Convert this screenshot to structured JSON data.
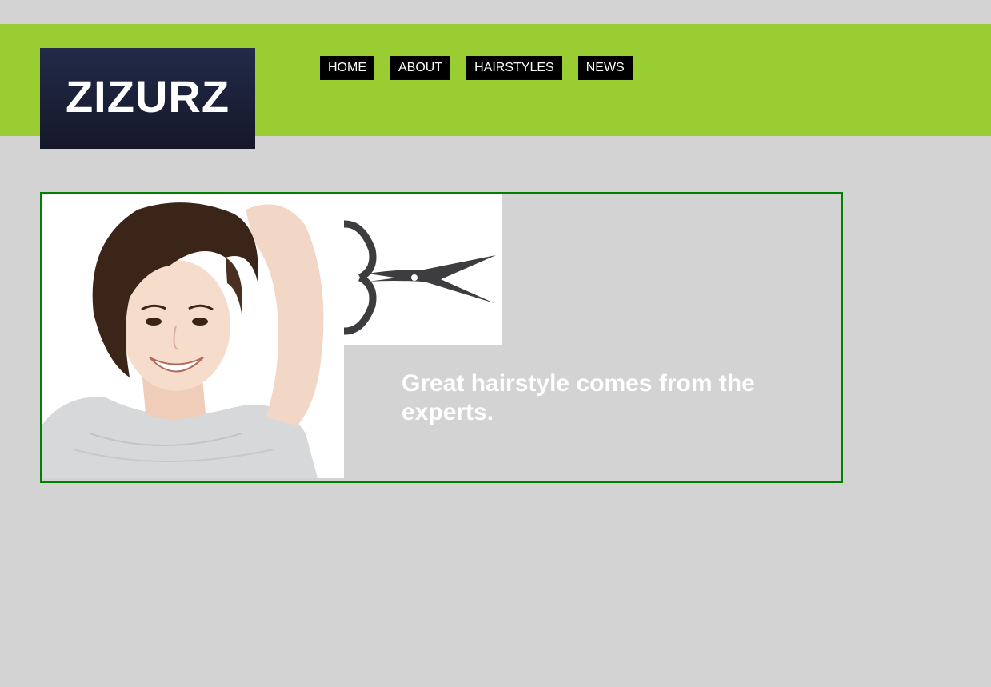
{
  "brand": {
    "logo_text": "ZIZURZ"
  },
  "nav": {
    "items": [
      {
        "label": "HOME"
      },
      {
        "label": "ABOUT"
      },
      {
        "label": "HAIRSTYLES"
      },
      {
        "label": "NEWS"
      }
    ]
  },
  "banner": {
    "tagline": "Great hairstyle comes from the experts.",
    "image_subject": "smiling woman with short brown hair",
    "icon": "scissors-icon"
  },
  "colors": {
    "page_background": "#d3d3d3",
    "header_band": "#9acd32",
    "nav_background": "#000000",
    "banner_border": "#008000",
    "logo_background": "#1c2038"
  }
}
